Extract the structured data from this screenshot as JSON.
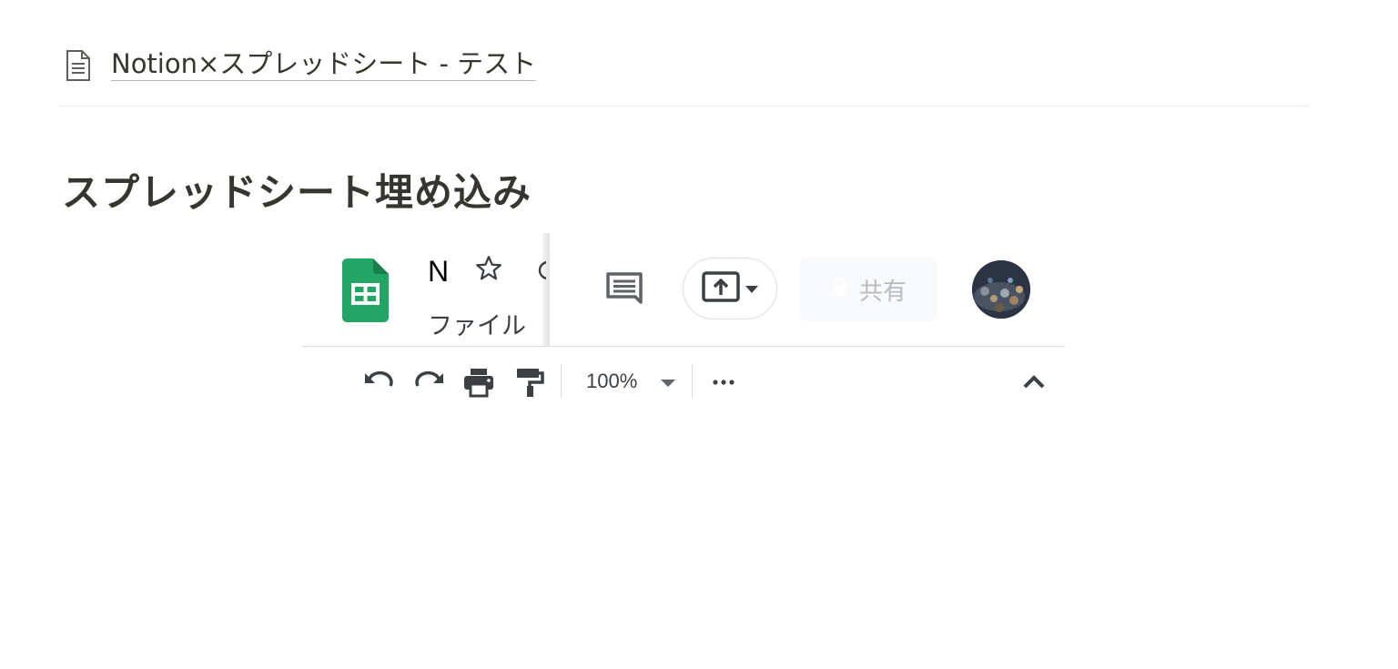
{
  "breadcrumb": {
    "page_icon": "page-icon",
    "title": "Notion×スプレッドシート - テスト"
  },
  "page": {
    "heading": "スプレッドシート埋め込み"
  },
  "embed": {
    "app_icon": "google-sheets-icon",
    "doc_title_visible": "N",
    "file_menu": "ファイル",
    "share_label": "共有",
    "zoom": "100%",
    "colors": {
      "sheets_green": "#23A566",
      "icon_gray": "#5f6368",
      "border": "#dadce0"
    },
    "toolbar_icons": [
      "undo-icon",
      "redo-icon",
      "print-icon",
      "paint-format-icon",
      "more-icon",
      "collapse-icon"
    ],
    "header_icons": [
      "star-icon",
      "comment-icon",
      "present-icon",
      "lock-icon",
      "avatar"
    ]
  }
}
